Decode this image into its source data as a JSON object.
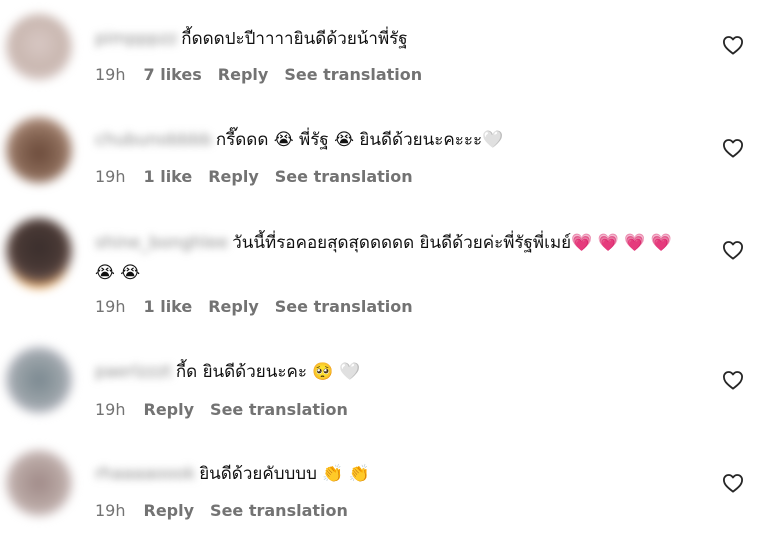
{
  "comments": [
    {
      "username": "pimpppzz",
      "text": "กี้ดดดปะปีาาาายินดีด้วยน้าพี่รัฐ",
      "time": "19h",
      "likes": "7 likes",
      "reply_label": "Reply",
      "translation_label": "See translation",
      "avatar_color": "#c9b7b0"
    },
    {
      "username": "chubunobbbb",
      "text": "กรี๊ดดด 😭  พี่รัฐ  😭  ยินดีด้วยนะคะะะ🤍",
      "time": "19h",
      "likes": "1 like",
      "reply_label": "Reply",
      "translation_label": "See translation",
      "avatar_color": "#8a6a58"
    },
    {
      "username": "shine_bonghlee",
      "text": "วันนี้ที่รอคอยสุดสุดดดดด ยินดีด้วยค่ะพี่รัฐพี่เมย์💗 💗 💗 💗 😭 😭",
      "time": "19h",
      "likes": "1 like",
      "reply_label": "Reply",
      "translation_label": "See translation",
      "avatar_color": "#4a3a36"
    },
    {
      "username": "paerlzzzt",
      "text": "กี้ด ยินดีด้วยนะคะ 🥺 🤍",
      "time": "19h",
      "likes": "",
      "reply_label": "Reply",
      "translation_label": "See translation",
      "avatar_color": "#9aa3a8"
    },
    {
      "username": "rhaaaaoook",
      "text": "ยินดีด้วยคับบบบ 👏 👏",
      "time": "19h",
      "likes": "",
      "reply_label": "Reply",
      "translation_label": "See translation",
      "avatar_color": "#b8a7a3"
    }
  ],
  "colors": {
    "meta_text": "#737373",
    "body_text": "#111111",
    "heart_stroke": "#262626"
  },
  "icons": {
    "like": "heart-outline-icon"
  }
}
